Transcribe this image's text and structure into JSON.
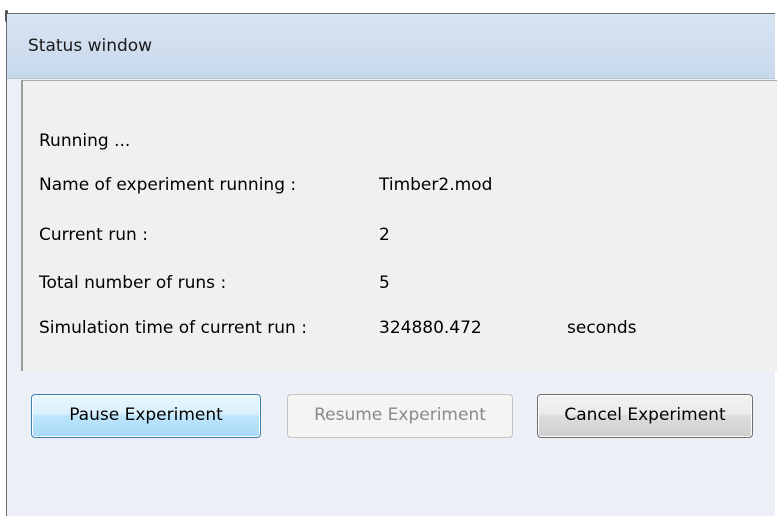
{
  "window": {
    "title": "Status window"
  },
  "status": {
    "state": "Running ...",
    "fields": [
      {
        "label": "Name of experiment running :",
        "value": "Timber2.mod"
      },
      {
        "label": "Current run :",
        "value": "2"
      },
      {
        "label": "Total number of runs :",
        "value": "5"
      },
      {
        "label": "Simulation time of current run :",
        "value": "324880.472",
        "unit": "seconds"
      }
    ]
  },
  "buttons": {
    "pause": "Pause Experiment",
    "resume": "Resume Experiment",
    "cancel": "Cancel Experiment"
  }
}
